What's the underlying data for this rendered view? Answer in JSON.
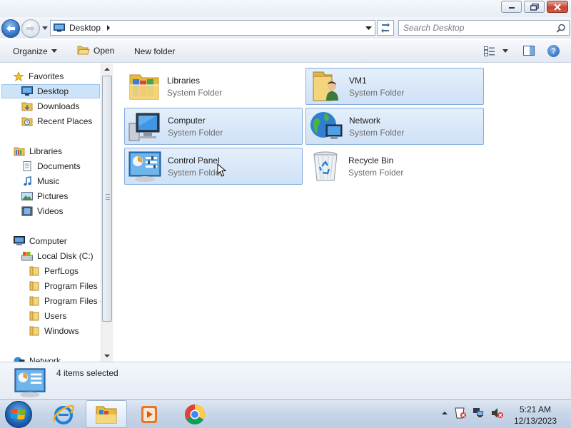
{
  "window": {
    "caption_buttons": [
      "minimize-icon",
      "restore-icon",
      "close-icon"
    ]
  },
  "navbar": {
    "address": {
      "location": "Desktop"
    },
    "search": {
      "placeholder": "Search Desktop"
    }
  },
  "commandbar": {
    "organize": "Organize",
    "open": "Open",
    "new_folder": "New folder"
  },
  "sidebar": {
    "favorites": {
      "label": "Favorites",
      "items": [
        "Desktop",
        "Downloads",
        "Recent Places"
      ],
      "selected": "Desktop"
    },
    "libraries": {
      "label": "Libraries",
      "items": [
        "Documents",
        "Music",
        "Pictures",
        "Videos"
      ]
    },
    "computer": {
      "label": "Computer",
      "drive": "Local Disk (C:)",
      "folders": [
        "PerfLogs",
        "Program Files",
        "Program Files (",
        "Users",
        "Windows"
      ]
    },
    "network": {
      "label": "Network"
    }
  },
  "items": [
    {
      "name": "Libraries",
      "type": "System Folder",
      "icon": "libraries-icon",
      "selected": false
    },
    {
      "name": "VM1",
      "type": "System Folder",
      "icon": "user-folder-icon",
      "selected": true
    },
    {
      "name": "Computer",
      "type": "System Folder",
      "icon": "computer-icon",
      "selected": true
    },
    {
      "name": "Network",
      "type": "System Folder",
      "icon": "network-icon",
      "selected": true
    },
    {
      "name": "Control Panel",
      "type": "System Folder",
      "icon": "control-panel-icon",
      "selected": true
    },
    {
      "name": "Recycle Bin",
      "type": "System Folder",
      "icon": "recycle-bin-icon",
      "selected": false
    }
  ],
  "details": {
    "status": "4 items selected"
  },
  "taskbar": {
    "apps": [
      "internet-explorer-icon",
      "windows-explorer-icon",
      "media-player-icon",
      "chrome-icon"
    ],
    "active_app": "windows-explorer-icon",
    "tray_icons": [
      "show-hidden-icons-icon",
      "action-center-icon",
      "network-status-icon",
      "volume-muted-icon"
    ],
    "time": "5:21 AM",
    "date": "12/13/2023"
  },
  "colors": {
    "selection_fill": "#cfe1f6",
    "selection_border": "#84acdd",
    "nav_selected": "#cde3f7",
    "secondary_text": "#6d6d6d"
  }
}
